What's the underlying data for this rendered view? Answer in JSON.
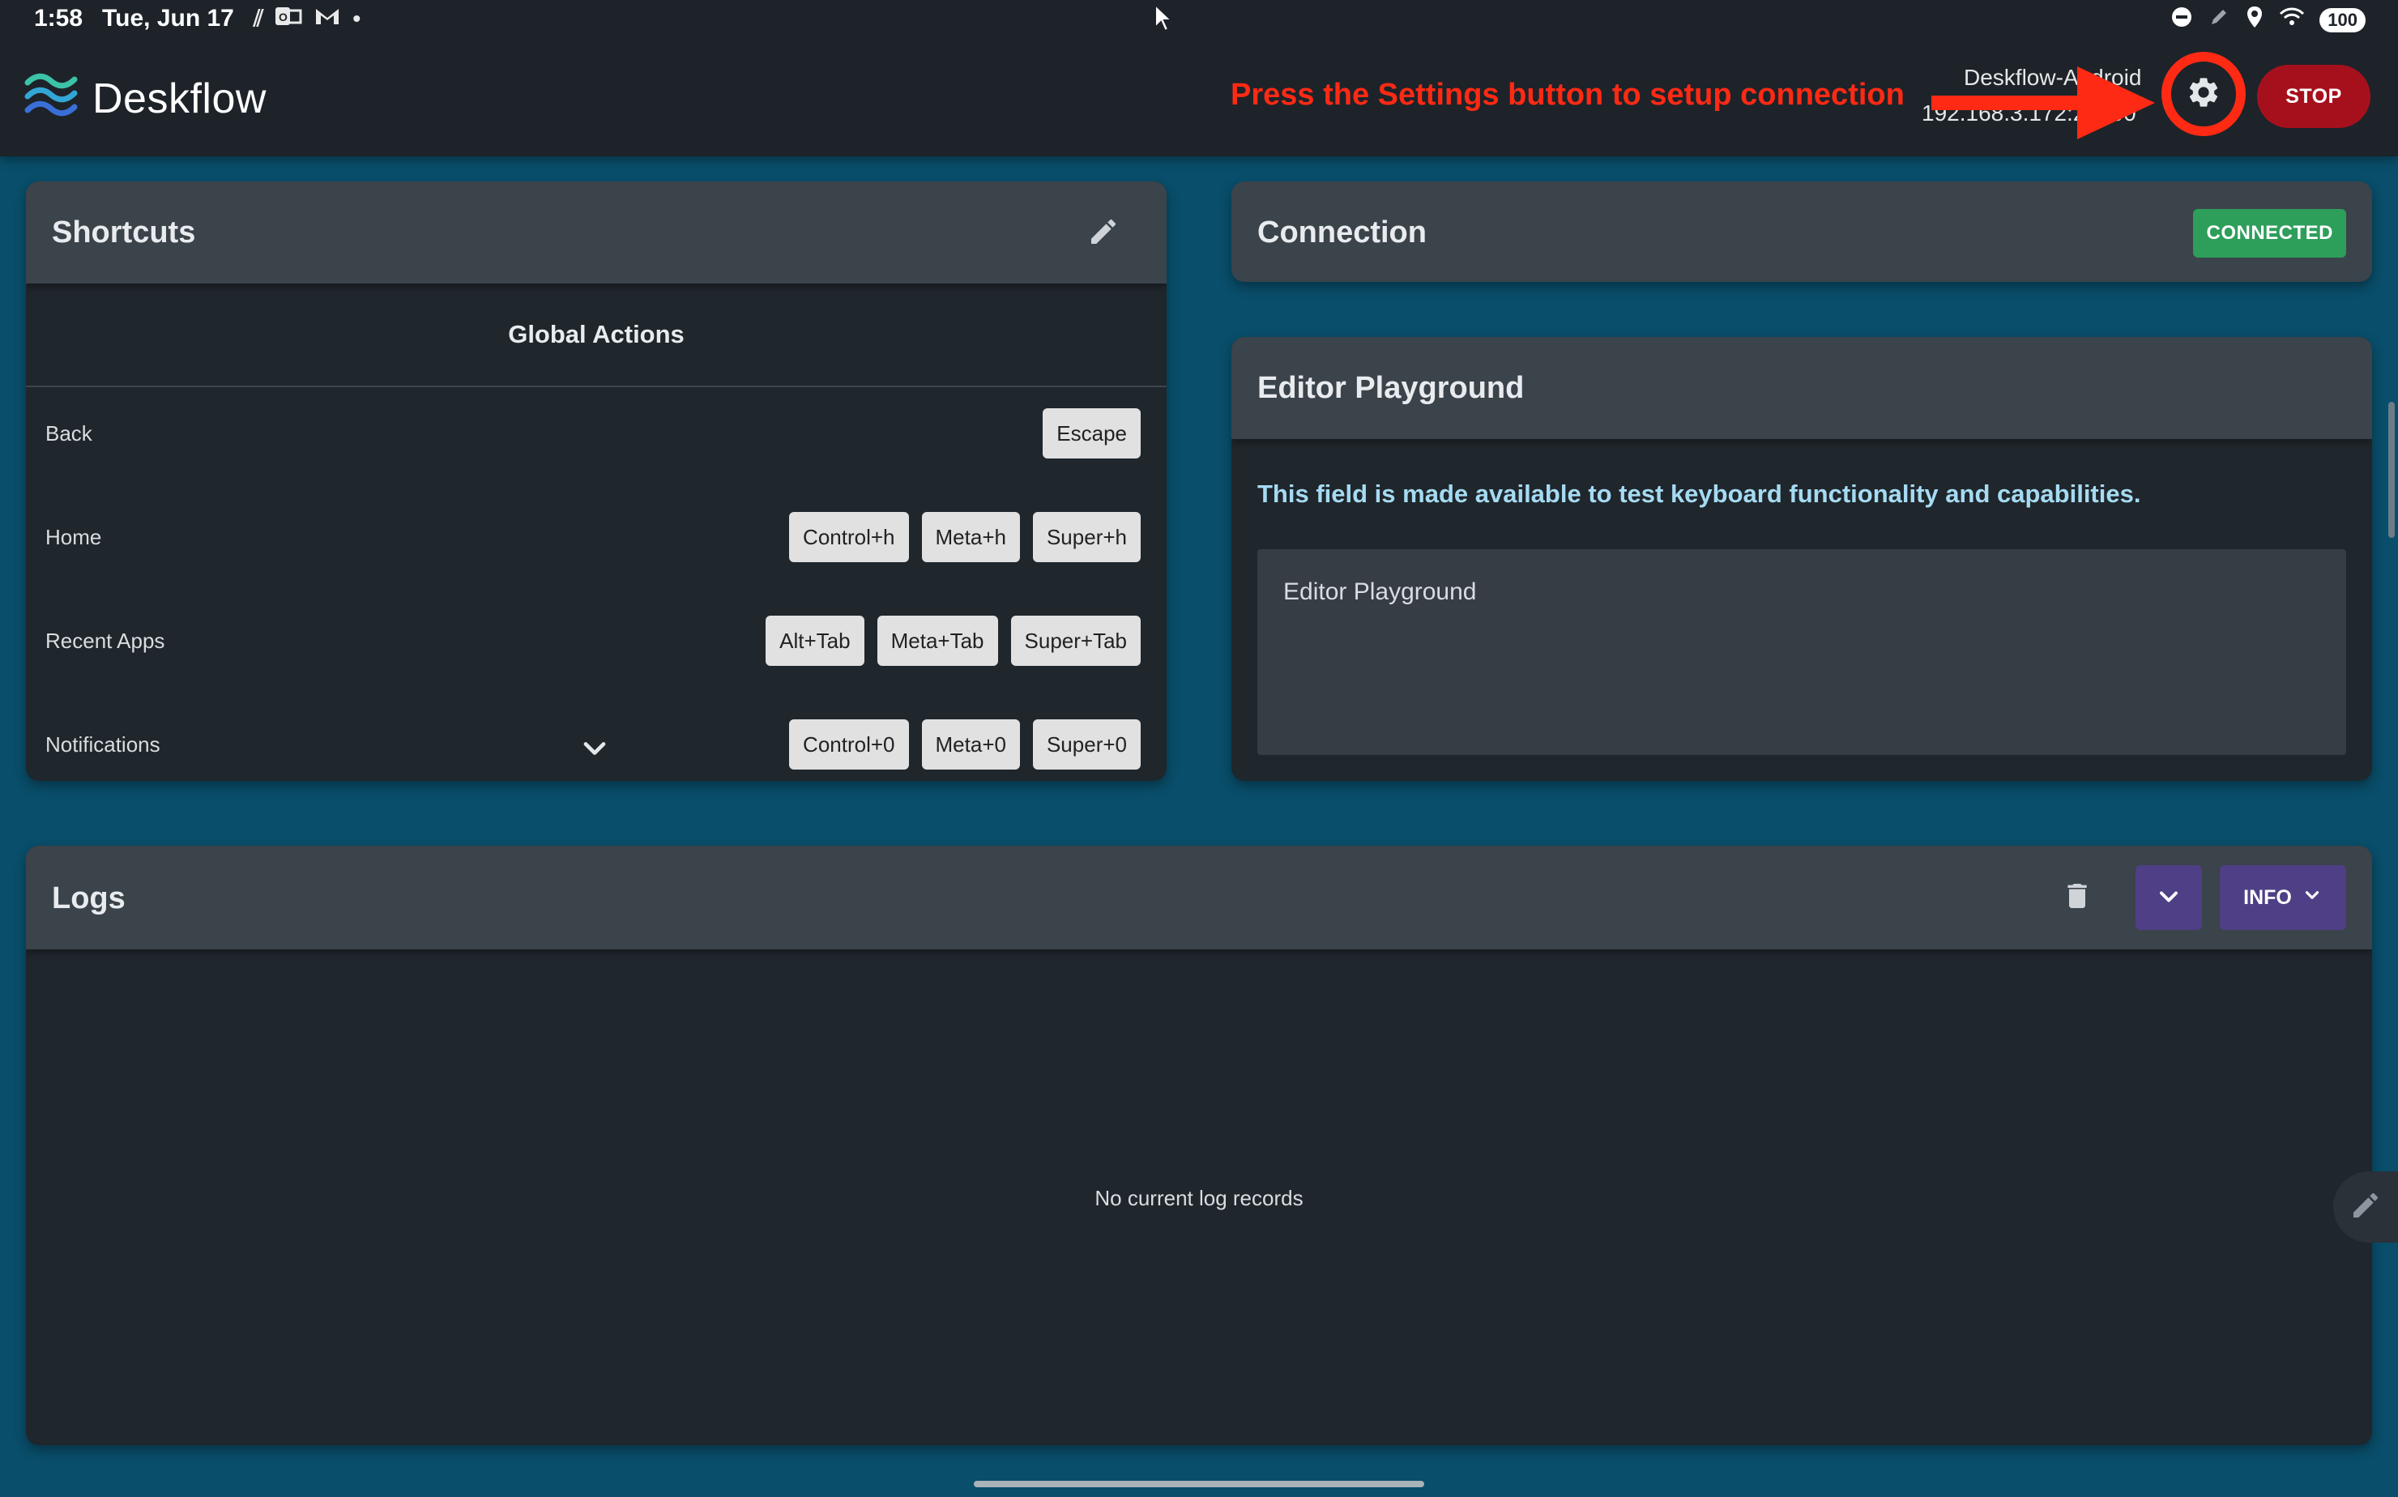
{
  "status_bar": {
    "time": "1:58",
    "date": "Tue, Jun 17",
    "battery": "100"
  },
  "app": {
    "name": "Deskflow"
  },
  "header": {
    "hint": "Press the Settings button to setup connection",
    "device_name": "Deskflow-Android",
    "device_ip": "192.168.3.172:24800",
    "stop_label": "STOP"
  },
  "shortcuts": {
    "title": "Shortcuts",
    "section_title": "Global Actions",
    "rows": [
      {
        "label": "Back",
        "keys": [
          "Escape"
        ]
      },
      {
        "label": "Home",
        "keys": [
          "Control+h",
          "Meta+h",
          "Super+h"
        ]
      },
      {
        "label": "Recent Apps",
        "keys": [
          "Alt+Tab",
          "Meta+Tab",
          "Super+Tab"
        ]
      },
      {
        "label": "Notifications",
        "keys": [
          "Control+0",
          "Meta+0",
          "Super+0"
        ]
      }
    ]
  },
  "connection": {
    "title": "Connection",
    "status": "CONNECTED"
  },
  "editor": {
    "title": "Editor Playground",
    "description": "This field is made available to test keyboard functionality and capabilities.",
    "placeholder": "Editor Playground"
  },
  "logs": {
    "title": "Logs",
    "level": "INFO",
    "empty_message": "No current log records"
  },
  "icons": {
    "settings": "gear-icon",
    "edit": "pencil-icon",
    "delete": "trash-icon",
    "expand": "chevron-down-icon"
  },
  "colors": {
    "background": "#094e6a",
    "header": "#1d2329",
    "card": "#1f262c",
    "card_header": "#3b434b",
    "stop": "#a6101d",
    "connected": "#2e9e5b",
    "log_buttons": "#4f3f86",
    "annotation": "#ff2a14",
    "description_text": "#a5dbf2"
  }
}
